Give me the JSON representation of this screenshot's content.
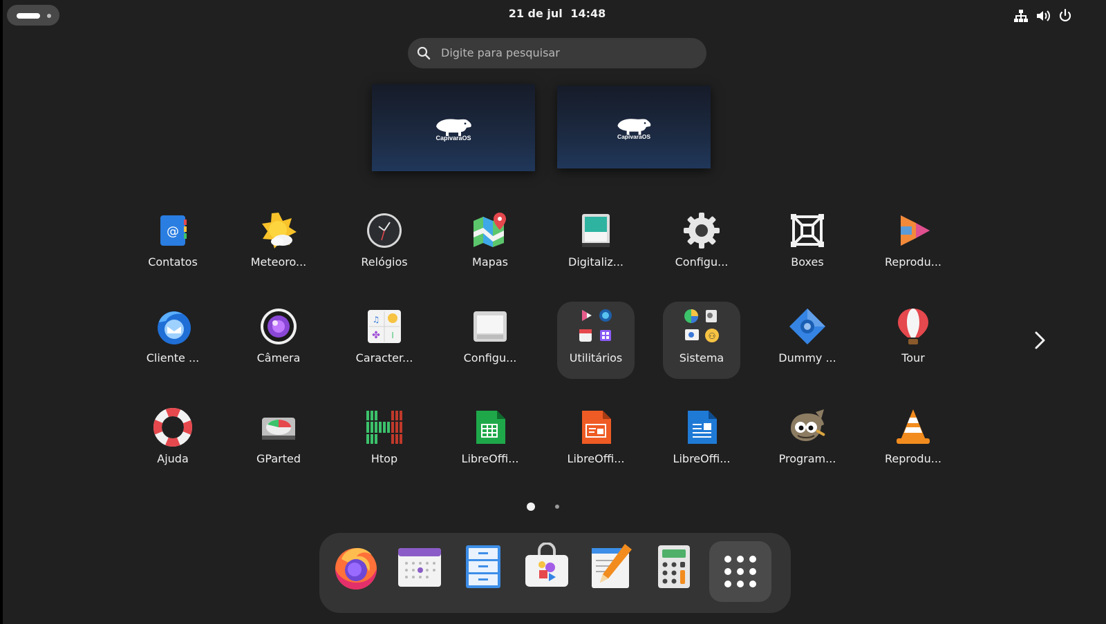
{
  "topbar": {
    "date": "21 de jul",
    "time": "14:48",
    "tray_icons": [
      "network-icon",
      "volume-icon",
      "power-icon"
    ]
  },
  "search": {
    "placeholder": "Digite para pesquisar"
  },
  "workspaces": [
    {
      "logo_text": "CapivaraOS"
    },
    {
      "logo_text": "CapivaraOS"
    }
  ],
  "apps": {
    "row1": [
      {
        "label": "Contatos",
        "icon": "contacts-icon"
      },
      {
        "label": "Meteoro...",
        "icon": "weather-icon"
      },
      {
        "label": "Relógios",
        "icon": "clocks-icon"
      },
      {
        "label": "Mapas",
        "icon": "maps-icon"
      },
      {
        "label": "Digitaliz...",
        "icon": "scanner-icon"
      },
      {
        "label": "Configu...",
        "icon": "gear-icon"
      },
      {
        "label": "Boxes",
        "icon": "boxes-icon"
      },
      {
        "label": "Reprodu...",
        "icon": "video-player-icon"
      }
    ],
    "row2": [
      {
        "label": "Cliente ...",
        "icon": "thunderbird-icon"
      },
      {
        "label": "Câmera",
        "icon": "camera-icon"
      },
      {
        "label": "Caracter...",
        "icon": "characters-icon"
      },
      {
        "label": "Configu...",
        "icon": "tweaks-icon"
      },
      {
        "label": "Utilitários",
        "icon": "utilities-folder-icon"
      },
      {
        "label": "Sistema",
        "icon": "system-folder-icon"
      },
      {
        "label": "Dummy ...",
        "icon": "dummy-icon"
      },
      {
        "label": "Tour",
        "icon": "tour-balloon-icon"
      }
    ],
    "row3": [
      {
        "label": "Ajuda",
        "icon": "help-lifebuoy-icon"
      },
      {
        "label": "GParted",
        "icon": "gparted-icon"
      },
      {
        "label": "Htop",
        "icon": "htop-icon"
      },
      {
        "label": "LibreOffi...",
        "icon": "libreoffice-calc-icon"
      },
      {
        "label": "LibreOffi...",
        "icon": "libreoffice-impress-icon"
      },
      {
        "label": "LibreOffi...",
        "icon": "libreoffice-writer-icon"
      },
      {
        "label": "Program...",
        "icon": "gimp-icon"
      },
      {
        "label": "Reprodu...",
        "icon": "vlc-icon"
      }
    ]
  },
  "pagination": {
    "current_page": 1,
    "total_pages": 2
  },
  "dock": [
    "firefox-icon",
    "calendar-icon",
    "files-icon",
    "software-icon",
    "text-editor-icon",
    "calculator-icon",
    "show-apps-icon"
  ],
  "colors": {
    "background": "#202020",
    "folder_bg": "#363636",
    "search_bg": "#3a3a3a",
    "dock_bg": "#343434"
  }
}
